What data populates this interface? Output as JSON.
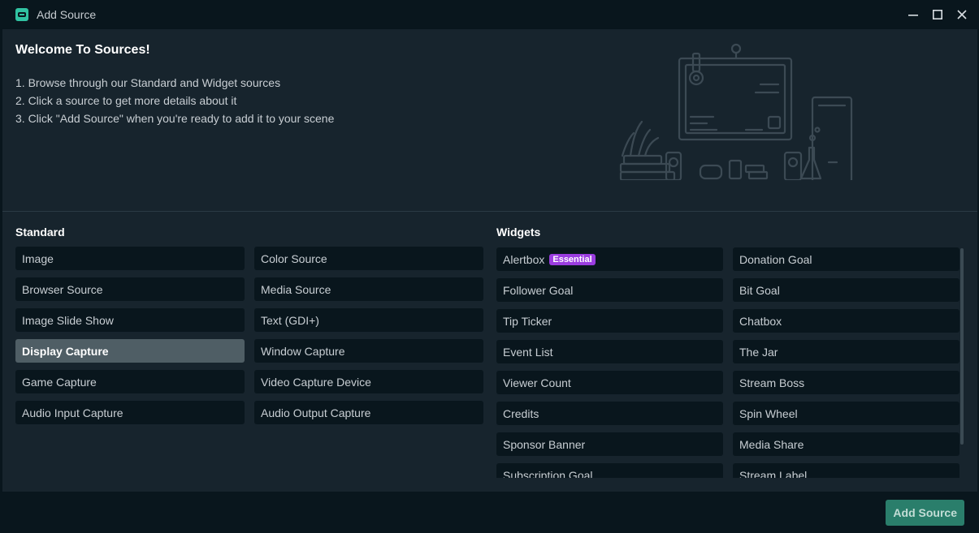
{
  "window": {
    "title": "Add Source",
    "controls": [
      "minimize",
      "maximize",
      "close"
    ]
  },
  "welcome": {
    "heading": "Welcome To Sources!",
    "steps": [
      "1. Browse through our Standard and Widget sources",
      "2. Click a source to get more details about it",
      "3. Click \"Add Source\" when you're ready to add it to your scene"
    ]
  },
  "standard": {
    "title": "Standard",
    "selected": "Display Capture",
    "col1": [
      "Image",
      "Browser Source",
      "Image Slide Show",
      "Display Capture",
      "Game Capture",
      "Audio Input Capture"
    ],
    "col2": [
      "Color Source",
      "Media Source",
      "Text (GDI+)",
      "Window Capture",
      "Video Capture Device",
      "Audio Output Capture"
    ]
  },
  "widgets": {
    "title": "Widgets",
    "badge": "Essential",
    "col1": [
      "Alertbox",
      "Follower Goal",
      "Tip Ticker",
      "Event List",
      "Viewer Count",
      "Credits",
      "Sponsor Banner",
      "Subscription Goal"
    ],
    "col2": [
      "Donation Goal",
      "Bit Goal",
      "Chatbox",
      "The Jar",
      "Stream Boss",
      "Spin Wheel",
      "Media Share",
      "Stream Label"
    ]
  },
  "footer": {
    "add_label": "Add Source"
  },
  "colors": {
    "accent": "#31c3a2",
    "badge": "#9b3de0",
    "button": "#2a7e6b"
  }
}
